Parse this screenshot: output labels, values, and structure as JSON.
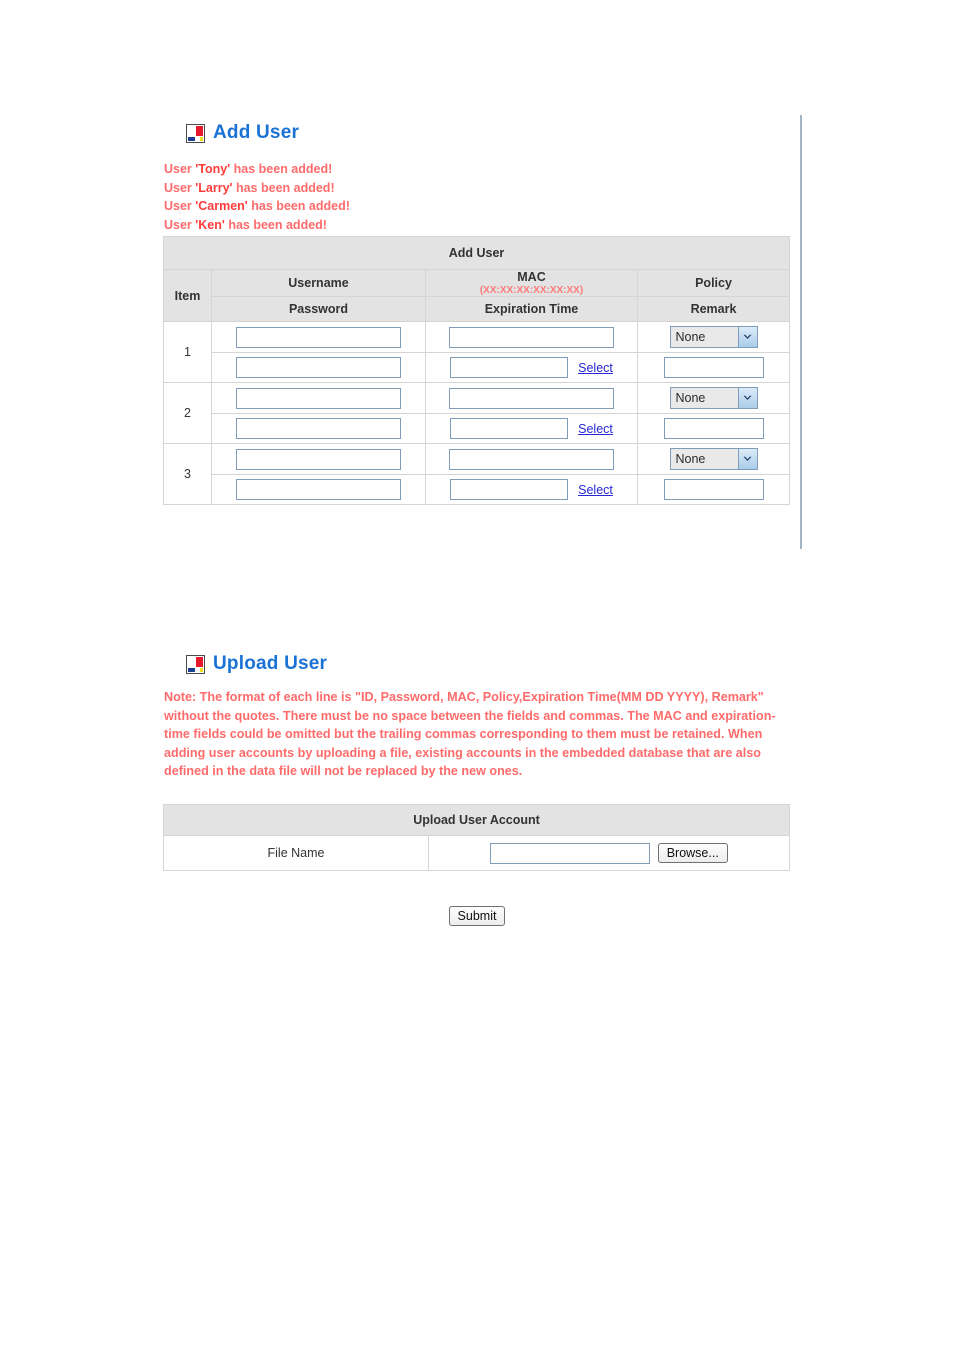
{
  "add_user": {
    "heading": "Add User",
    "icon": "mondrian-icon",
    "messages": [
      {
        "prefix": "User ",
        "name": "'Tony'",
        "suffix": " has been added!"
      },
      {
        "prefix": "User ",
        "name": "'Larry'",
        "suffix": " has been added!"
      },
      {
        "prefix": "User ",
        "name": "'Carmen'",
        "suffix": " has been added!"
      },
      {
        "prefix": "User ",
        "name": "'Ken'",
        "suffix": " has been added!"
      }
    ],
    "table": {
      "caption": "Add User",
      "headers": {
        "item": "Item",
        "username": "Username",
        "mac": "MAC",
        "mac_format": "(XX:XX:XX:XX:XX:XX)",
        "policy": "Policy",
        "password": "Password",
        "expiration": "Expiration Time",
        "remark": "Remark"
      },
      "select_link": "Select",
      "policy_selected": "None",
      "policy_options": [
        "None"
      ],
      "rows": [
        {
          "item": "1",
          "username": "",
          "mac": "",
          "policy": "None",
          "password": "",
          "expiration": "",
          "remark": ""
        },
        {
          "item": "2",
          "username": "",
          "mac": "",
          "policy": "None",
          "password": "",
          "expiration": "",
          "remark": ""
        },
        {
          "item": "3",
          "username": "",
          "mac": "",
          "policy": "None",
          "password": "",
          "expiration": "",
          "remark": ""
        }
      ]
    }
  },
  "upload_user": {
    "heading": "Upload User",
    "icon": "mondrian-icon",
    "note": "Note: The format of each line is \"ID, Password, MAC, Policy,Expiration Time(MM DD YYYY), Remark\" without the quotes. There must be no space between the fields and commas. The MAC and expiration-time fields could be omitted but the trailing commas corresponding to them must be retained. When adding user accounts by uploading a file, existing accounts in the embedded database that are also defined in the data file will not be replaced by the new ones.",
    "table": {
      "caption": "Upload User Account",
      "file_label": "File Name",
      "file_value": "",
      "browse_label": "Browse..."
    }
  },
  "submit_label": "Submit",
  "colors": {
    "heading_blue": "#1a73d4",
    "note_red": "#ff6b6b",
    "header_gray": "#e3e3e3",
    "link_blue": "#2727d6",
    "input_border": "#7f9db9"
  }
}
